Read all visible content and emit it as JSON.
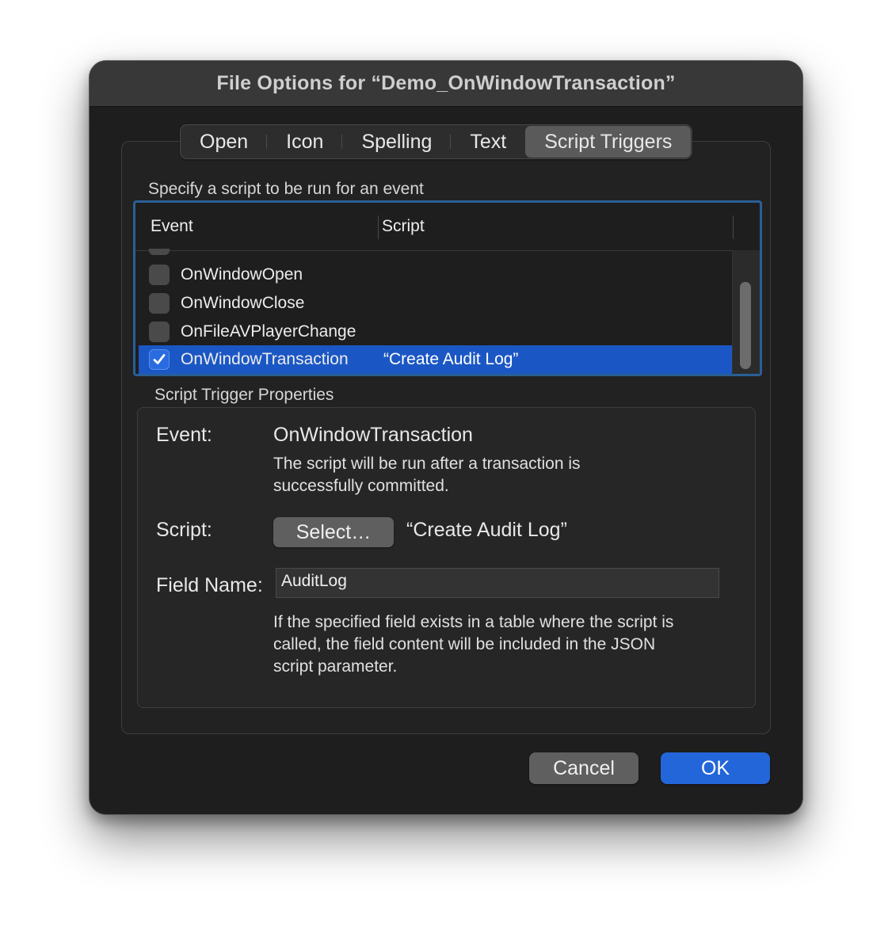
{
  "window": {
    "title": "File Options for “Demo_OnWindowTransaction”"
  },
  "tabs": [
    {
      "label": "Open"
    },
    {
      "label": "Icon"
    },
    {
      "label": "Spelling"
    },
    {
      "label": "Text"
    },
    {
      "label": "Script Triggers",
      "selected": true
    }
  ],
  "triggers": {
    "section_label": "Specify a script to be run for an event",
    "columns": {
      "event": "Event",
      "script": "Script"
    },
    "rows": [
      {
        "event": "OnWindowOpen",
        "checked": false,
        "script": ""
      },
      {
        "event": "OnWindowClose",
        "checked": false,
        "script": ""
      },
      {
        "event": "OnFileAVPlayerChange",
        "checked": false,
        "script": ""
      },
      {
        "event": "OnWindowTransaction",
        "checked": true,
        "script": "“Create Audit Log”",
        "selected": true
      }
    ]
  },
  "properties": {
    "section_label": "Script Trigger Properties",
    "event_label": "Event:",
    "event_value": "OnWindowTransaction",
    "event_description_line1": "The script will be run after a transaction is",
    "event_description_line2": "successfully committed.",
    "script_label": "Script:",
    "select_button": "Select…",
    "script_value": "“Create Audit Log”",
    "field_name_label": "Field Name:",
    "field_name_value": "AuditLog",
    "field_description_line1": "If the specified field exists in a table where the script is",
    "field_description_line2": "called, the field content will be included in the JSON",
    "field_description_line3": "script parameter."
  },
  "buttons": {
    "cancel": "Cancel",
    "ok": "OK"
  },
  "colors": {
    "accent": "#2366d9",
    "selection": "#1b57c4",
    "focus_ring": "#2a5f95"
  }
}
